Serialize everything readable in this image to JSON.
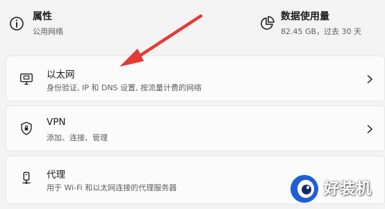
{
  "top": {
    "properties": {
      "title": "属性",
      "subtitle": "公用网络",
      "icon": "info-icon"
    },
    "data_usage": {
      "title": "数据使用量",
      "subtitle": "82.45 GB，过去 30 天",
      "icon": "pie-chart-icon"
    }
  },
  "cards": [
    {
      "title": "以太网",
      "subtitle": "身份验证, IP 和 DNS 设置, 按流量计费的网络",
      "icon": "ethernet-icon"
    },
    {
      "title": "VPN",
      "subtitle": "添加、连接、管理",
      "icon": "vpn-shield-icon"
    },
    {
      "title": "代理",
      "subtitle": "用于 Wi-Fi 和以太网连接的代理服务器",
      "icon": "proxy-icon"
    }
  ],
  "annotation": {
    "arrow_color": "#e53935"
  },
  "watermark": {
    "text": "好装机"
  }
}
